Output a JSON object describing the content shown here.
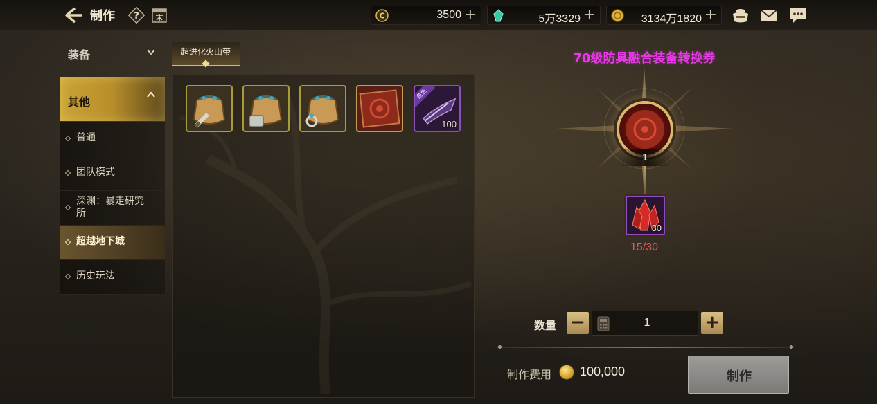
{
  "header": {
    "title": "制作",
    "currencies": [
      {
        "name": "ceras",
        "icon": "ceras-coin-icon",
        "value": "3500"
      },
      {
        "name": "crystal",
        "icon": "green-crystal-icon",
        "value": "5万3329"
      },
      {
        "name": "gold",
        "icon": "gold-coin-icon",
        "value": "3134万1820"
      }
    ],
    "plus_glyph": "+"
  },
  "sidebar": {
    "categories": [
      {
        "label": "装备",
        "expanded": false
      },
      {
        "label": "其他",
        "expanded": true
      }
    ],
    "sub_items": [
      {
        "label": "普通"
      },
      {
        "label": "团队模式"
      },
      {
        "label": "深渊：暴走研究所"
      },
      {
        "label": "超越地下城",
        "selected": true
      },
      {
        "label": "历史玩法"
      }
    ]
  },
  "tab": {
    "label": "超进化火山带"
  },
  "items": [
    {
      "icon": "treasure-bag-sword-icon",
      "frame": "yellow"
    },
    {
      "icon": "treasure-bag-armor-icon",
      "frame": "yellow"
    },
    {
      "icon": "treasure-bag-ring-icon",
      "frame": "yellow"
    },
    {
      "icon": "red-voucher-scroll-icon",
      "frame": "orange"
    },
    {
      "icon": "purple-gear-icon",
      "frame": "purple",
      "tag": "角色",
      "qty": "100"
    }
  ],
  "detail": {
    "title": "70级防具融合装备转换券",
    "title_color": "#e63ae6",
    "output_count": "1",
    "material": {
      "icon": "red-crystal-icon",
      "qty": "30",
      "progress": "15/30",
      "progress_color": "#d46060"
    },
    "quantity_label": "数量",
    "quantity_value": "1",
    "minus_glyph": "−",
    "plus_glyph": "+",
    "cost_label": "制作费用",
    "cost_value": "100,000",
    "craft_label": "制作"
  }
}
